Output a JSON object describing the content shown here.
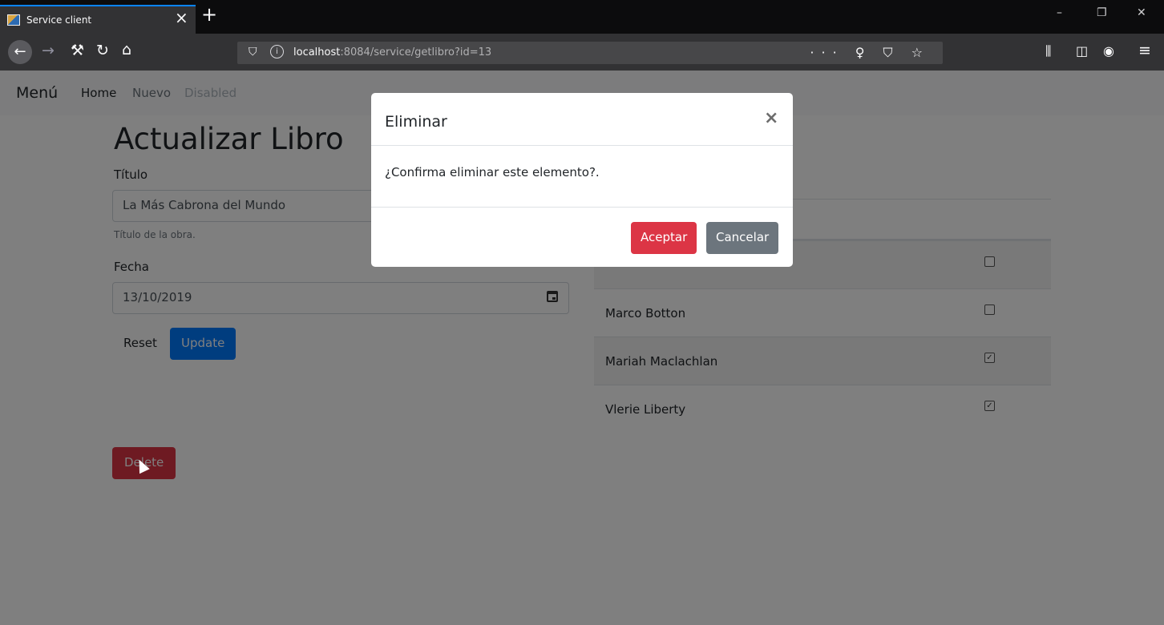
{
  "browser": {
    "tab_title": "Service client",
    "tab_close": "×",
    "new_tab": "+",
    "window_controls": {
      "minimize": "–",
      "restore": "❐",
      "close": "✕"
    },
    "nav": {
      "back": "←",
      "forward": "→",
      "tools": "⚒",
      "reload": "↻",
      "home": "⌂"
    },
    "url_host": "localhost",
    "url_rest": ":8084/service/getlibro?id=13",
    "url_actions": "··· ♀ ⛉ ☆",
    "toolbar_right": {
      "library": "⫼",
      "sidebar": "◫",
      "account": "◉",
      "menu": "≡"
    }
  },
  "site_nav": {
    "brand": "Menú",
    "links": [
      "Home",
      "Nuevo",
      "Disabled"
    ]
  },
  "form": {
    "heading": "Actualizar Libro",
    "title_label": "Título",
    "title_value": "La Más Cabrona del Mundo",
    "title_help": "Título de la obra.",
    "date_label": "Fecha",
    "date_value": "13/10/2019",
    "reset_label": "Reset",
    "update_label": "Update",
    "delete_label": "Delete"
  },
  "table": {
    "rows": [
      {
        "name": "",
        "checked": false
      },
      {
        "name": "Marco Botton",
        "checked": false
      },
      {
        "name": "Mariah Maclachlan",
        "checked": true
      },
      {
        "name": "Vlerie Liberty",
        "checked": true
      }
    ]
  },
  "modal": {
    "title": "Eliminar",
    "close": "×",
    "body": "¿Confirma eliminar este elemento?.",
    "accept_label": "Aceptar",
    "cancel_label": "Cancelar"
  },
  "colors": {
    "primary": "#007bff",
    "danger": "#dc3545",
    "secondary": "#6c757d"
  }
}
